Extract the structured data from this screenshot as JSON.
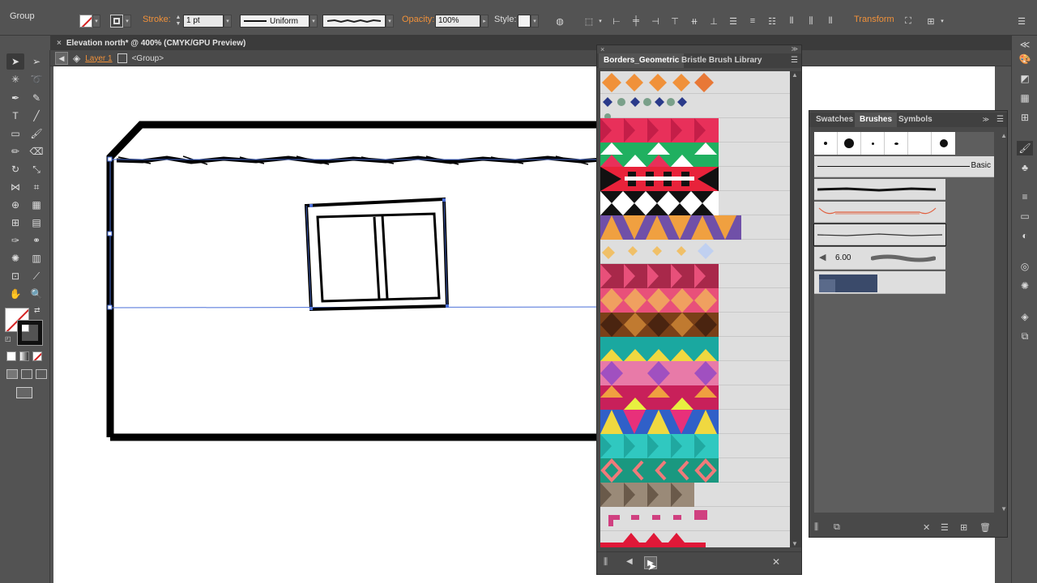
{
  "control_bar": {
    "selection_type": "Group",
    "stroke_label": "Stroke:",
    "stroke_weight": "1 pt",
    "stroke_profile": "Uniform",
    "opacity_label": "Opacity:",
    "opacity_value": "100%",
    "style_label": "Style:",
    "transform_label": "Transform"
  },
  "document": {
    "tab_title": "Elevation north* @ 400% (CMYK/GPU Preview)",
    "breadcrumb_layer": "Layer 1",
    "breadcrumb_group": "<Group>"
  },
  "borders_panel": {
    "tabs": [
      "Borders_Geometric",
      "Bristle Brush Library"
    ]
  },
  "brushes_panel": {
    "tabs": [
      "Swatches",
      "Brushes",
      "Symbols"
    ],
    "basic_label": "Basic",
    "bristle_size": "6.00"
  },
  "colors": {
    "accent_orange": "#f0913a",
    "selection_blue": "#4a6fd8",
    "panel_bg": "#494949",
    "ui_bg": "#535353"
  }
}
